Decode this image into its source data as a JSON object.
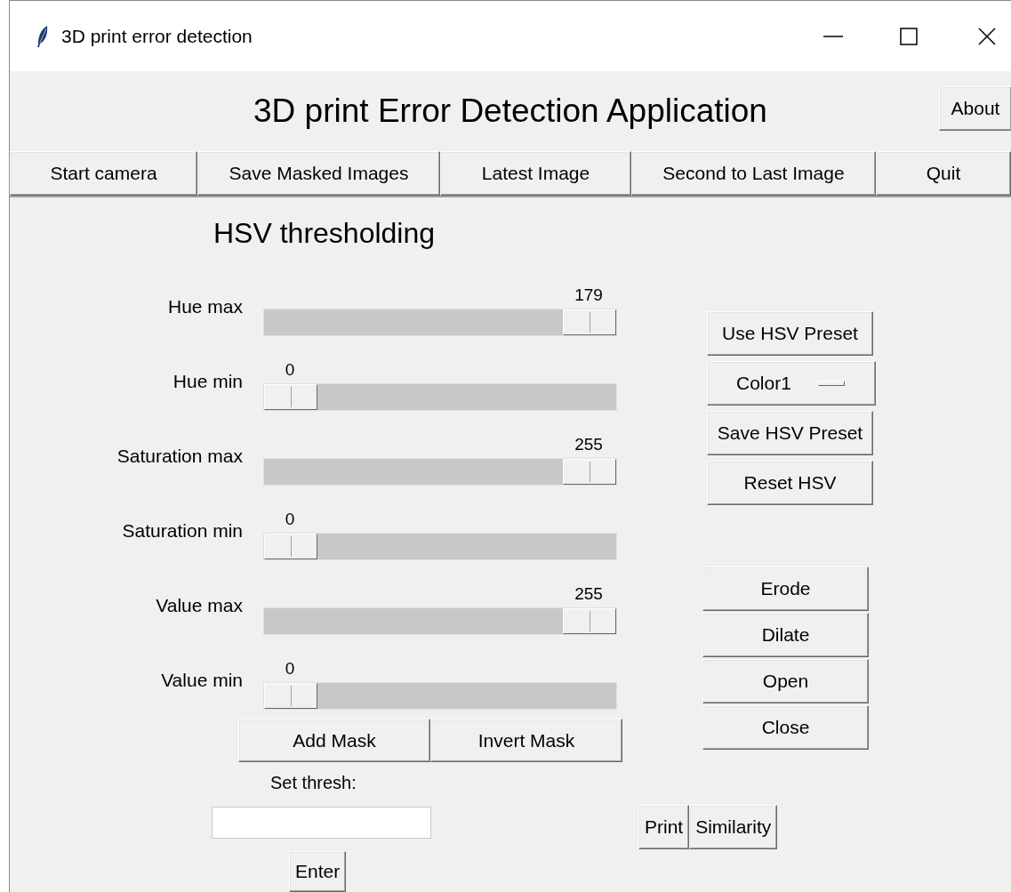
{
  "window": {
    "title": "3D print error detection"
  },
  "app_title": "3D print Error Detection Application",
  "about_button": "About",
  "toolbar": [
    "Start camera",
    "Save Masked Images",
    "Latest Image",
    "Second to Last Image",
    "Quit"
  ],
  "section_title": "HSV thresholding",
  "sliders": [
    {
      "label": "Hue max",
      "value": "179",
      "level": 1
    },
    {
      "label": "Hue min",
      "value": "0",
      "level": 0
    },
    {
      "label": "Saturation max",
      "value": "255",
      "level": 1
    },
    {
      "label": "Saturation min",
      "value": "0",
      "level": 0
    },
    {
      "label": "Value max",
      "value": "255",
      "level": 1
    },
    {
      "label": "Value min",
      "value": "0",
      "level": 0
    }
  ],
  "mask_buttons": [
    "Add Mask",
    "Invert Mask"
  ],
  "preset_controls": [
    {
      "kind": "button",
      "label": "Use HSV Preset"
    },
    {
      "kind": "dropdown",
      "label": "Color1"
    },
    {
      "kind": "button",
      "label": "Save HSV Preset"
    },
    {
      "kind": "button",
      "label": "Reset HSV"
    }
  ],
  "morphology_buttons": [
    "Erode",
    "Dilate",
    "Open",
    "Close"
  ],
  "thresh": {
    "label": "Set thresh:",
    "button": "Enter"
  },
  "bottom_buttons": [
    "Print",
    "Similarity"
  ]
}
